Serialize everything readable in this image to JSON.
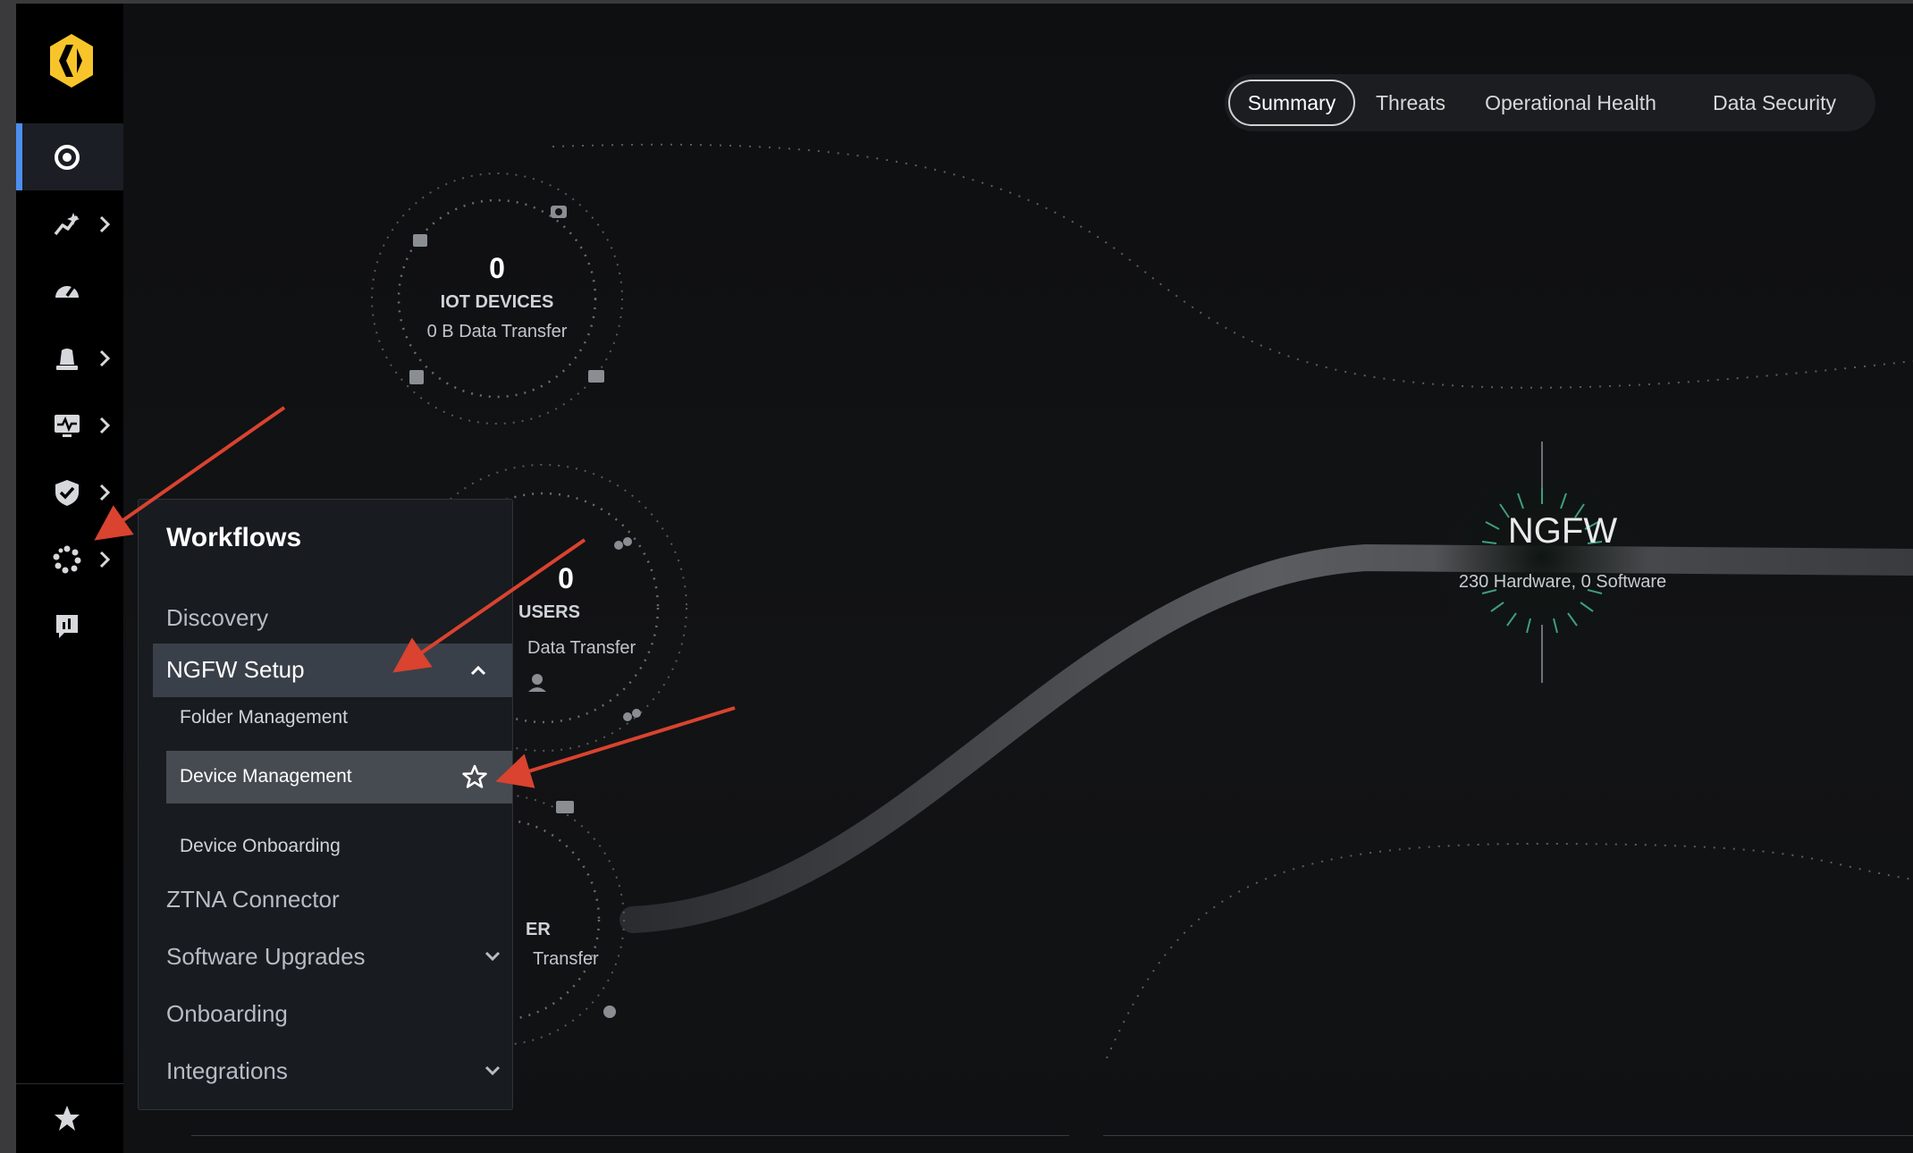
{
  "tabs": [
    {
      "label": "Summary",
      "selected": true
    },
    {
      "label": "Threats",
      "selected": false
    },
    {
      "label": "Operational Health",
      "selected": false
    },
    {
      "label": "Data Security",
      "selected": false
    }
  ],
  "sidebar": {
    "items": [
      {
        "icon": "dashboard-target-icon",
        "active": true
      },
      {
        "icon": "insights-icon",
        "chevron": true
      },
      {
        "icon": "speedometer-icon"
      },
      {
        "icon": "alarm-bell-icon",
        "chevron": true
      },
      {
        "icon": "monitor-pulse-icon",
        "chevron": true
      },
      {
        "icon": "shield-check-icon",
        "chevron": true
      },
      {
        "icon": "workflows-dots-icon",
        "chevron": true
      },
      {
        "icon": "reports-chart-icon"
      }
    ],
    "favorites_icon": "star-icon"
  },
  "nodes": {
    "iot": {
      "count": "0",
      "label": "IOT DEVICES",
      "sub": "0 B Data Transfer"
    },
    "users": {
      "count": "0",
      "label": "USERS",
      "sub": "Data Transfer"
    },
    "third": {
      "label": "ER",
      "sub": "Transfer"
    },
    "ngfw": {
      "title": "NGFW",
      "sub": "230 Hardware, 0 Software"
    }
  },
  "flyout": {
    "title": "Workflows",
    "items": {
      "discovery": "Discovery",
      "ngfw_setup": "NGFW Setup",
      "folder_management": "Folder Management",
      "device_management": "Device Management",
      "device_onboarding": "Device Onboarding",
      "ztna_connector": "ZTNA Connector",
      "software_upgrades": "Software Upgrades",
      "onboarding": "Onboarding",
      "integrations": "Integrations"
    }
  },
  "colors": {
    "accent_blue": "#4d8ff0",
    "logo_yellow": "#f7c52a",
    "annotation_red": "#d9432f"
  }
}
